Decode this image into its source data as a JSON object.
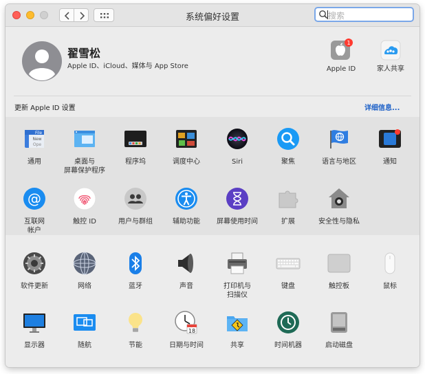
{
  "window": {
    "title": "系统偏好设置"
  },
  "search": {
    "placeholder": "搜索"
  },
  "user": {
    "name": "翟雪松",
    "subtitle": "Apple ID、iCloud、媒体与 App Store"
  },
  "top_items": [
    {
      "label": "Apple ID",
      "icon": "apple-id-icon",
      "badge": "1"
    },
    {
      "label": "家人共享",
      "icon": "family-sharing-icon"
    }
  ],
  "update_banner": {
    "text": "更新 Apple ID 设置",
    "link": "详细信息..."
  },
  "row1": [
    {
      "label": "通用",
      "icon": "general-icon"
    },
    {
      "label": "桌面与\n屏幕保护程序",
      "icon": "desktop-screensaver-icon"
    },
    {
      "label": "程序坞",
      "icon": "dock-icon"
    },
    {
      "label": "调度中心",
      "icon": "mission-control-icon"
    },
    {
      "label": "Siri",
      "icon": "siri-icon"
    },
    {
      "label": "聚焦",
      "icon": "spotlight-icon"
    },
    {
      "label": "语言与地区",
      "icon": "language-region-icon"
    },
    {
      "label": "通知",
      "icon": "notifications-icon"
    }
  ],
  "row2": [
    {
      "label": "互联网\n帐户",
      "icon": "internet-accounts-icon"
    },
    {
      "label": "触控 ID",
      "icon": "touch-id-icon"
    },
    {
      "label": "用户与群组",
      "icon": "users-groups-icon"
    },
    {
      "label": "辅助功能",
      "icon": "accessibility-icon"
    },
    {
      "label": "屏幕使用时间",
      "icon": "screen-time-icon"
    },
    {
      "label": "扩展",
      "icon": "extensions-icon"
    },
    {
      "label": "安全性与隐私",
      "icon": "security-privacy-icon"
    }
  ],
  "row3": [
    {
      "label": "软件更新",
      "icon": "software-update-icon"
    },
    {
      "label": "网络",
      "icon": "network-icon"
    },
    {
      "label": "蓝牙",
      "icon": "bluetooth-icon"
    },
    {
      "label": "声音",
      "icon": "sound-icon"
    },
    {
      "label": "打印机与\n扫描仪",
      "icon": "printers-scanners-icon"
    },
    {
      "label": "键盘",
      "icon": "keyboard-icon"
    },
    {
      "label": "触控板",
      "icon": "trackpad-icon"
    },
    {
      "label": "鼠标",
      "icon": "mouse-icon"
    }
  ],
  "row4": [
    {
      "label": "显示器",
      "icon": "displays-icon"
    },
    {
      "label": "随航",
      "icon": "sidecar-icon"
    },
    {
      "label": "节能",
      "icon": "energy-saver-icon"
    },
    {
      "label": "日期与时间",
      "icon": "date-time-icon",
      "date_number": "18"
    },
    {
      "label": "共享",
      "icon": "sharing-icon"
    },
    {
      "label": "时间机器",
      "icon": "time-machine-icon"
    },
    {
      "label": "启动磁盘",
      "icon": "startup-disk-icon"
    }
  ]
}
